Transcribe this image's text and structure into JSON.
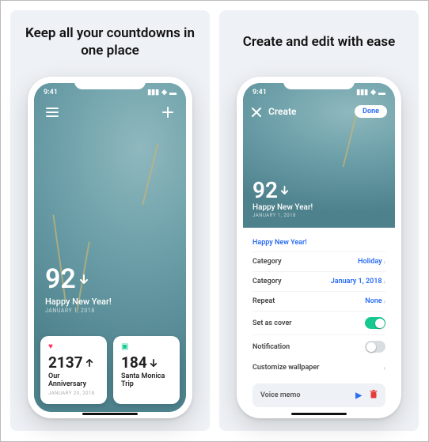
{
  "panels": {
    "left_title": "Keep all your countdowns in one place",
    "right_title": "Create and edit with ease"
  },
  "status": {
    "time": "9:41"
  },
  "screen1": {
    "main": {
      "number": "92",
      "direction": "down",
      "label": "Happy New Year!",
      "date": "JANUARY 1, 2018"
    },
    "cards": [
      {
        "icon": "heart",
        "number": "2137",
        "direction": "up",
        "label": "Our Anniversary",
        "date": "JANUARY 20, 2018"
      },
      {
        "icon": "calendar",
        "number": "184",
        "direction": "down",
        "label": "Santa Monica Trip",
        "date": ""
      }
    ]
  },
  "screen2": {
    "header": {
      "title": "Create",
      "done_label": "Done",
      "number": "92",
      "direction": "down",
      "label": "Happy New Year!",
      "date": "JANUARY 1, 2018"
    },
    "name_field": "Happy New Year!",
    "rows": {
      "category": {
        "key": "Category",
        "value": "Holiday"
      },
      "date": {
        "key": "Category",
        "value": "January 1, 2018"
      },
      "repeat": {
        "key": "Repeat",
        "value": "None"
      },
      "cover": {
        "key": "Set as cover",
        "on": true
      },
      "notification": {
        "key": "Notification",
        "on": false
      }
    },
    "customize_label": "Customize wallpaper",
    "voice_label": "Voice memo"
  }
}
